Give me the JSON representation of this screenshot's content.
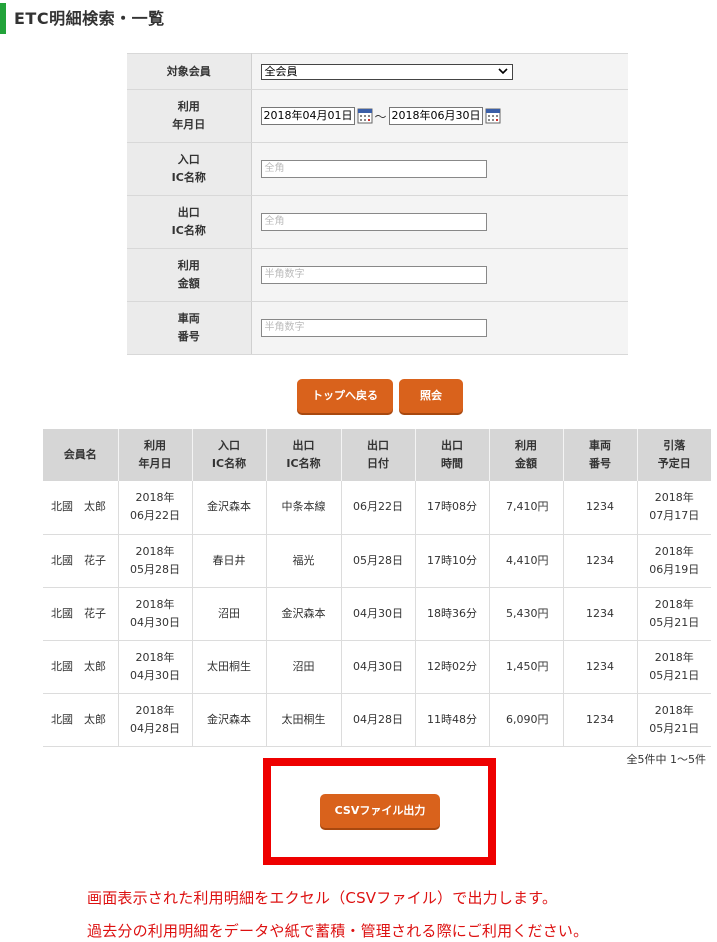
{
  "page": {
    "title": "ETC明細検索・一覧",
    "accent": "#22a33a"
  },
  "form": {
    "member": {
      "label": "対象会員",
      "value": "全会員"
    },
    "period": {
      "label1": "利用",
      "label2": "年月日",
      "from": "2018年04月01日",
      "separator": "～",
      "to": "2018年06月30日"
    },
    "entry_ic": {
      "label1": "入口",
      "label2": "IC名称",
      "placeholder": "全角"
    },
    "exit_ic": {
      "label1": "出口",
      "label2": "IC名称",
      "placeholder": "全角"
    },
    "amount": {
      "label1": "利用",
      "label2": "金額",
      "placeholder": "半角数字"
    },
    "vehicle": {
      "label1": "車両",
      "label2": "番号",
      "placeholder": "半角数字"
    }
  },
  "buttons": {
    "back_top": "トップへ戻る",
    "search": "照会",
    "csv": "CSVファイル出力",
    "color": "#d9621c"
  },
  "table": {
    "headers": [
      [
        "会員名",
        ""
      ],
      [
        "利用",
        "年月日"
      ],
      [
        "入口",
        "IC名称"
      ],
      [
        "出口",
        "IC名称"
      ],
      [
        "出口",
        "日付"
      ],
      [
        "出口",
        "時間"
      ],
      [
        "利用",
        "金額"
      ],
      [
        "車両",
        "番号"
      ],
      [
        "引落",
        "予定日"
      ]
    ],
    "rows": [
      {
        "member": "北國　太郎",
        "date1": "2018年",
        "date2": "06月22日",
        "entry": "金沢森本",
        "exit": "中条本線",
        "exit_date": "06月22日",
        "exit_time": "17時08分",
        "amount": "7,410円",
        "vehicle": "1234",
        "debit1": "2018年",
        "debit2": "07月17日"
      },
      {
        "member": "北國　花子",
        "date1": "2018年",
        "date2": "05月28日",
        "entry": "春日井",
        "exit": "福光",
        "exit_date": "05月28日",
        "exit_time": "17時10分",
        "amount": "4,410円",
        "vehicle": "1234",
        "debit1": "2018年",
        "debit2": "06月19日"
      },
      {
        "member": "北國　花子",
        "date1": "2018年",
        "date2": "04月30日",
        "entry": "沼田",
        "exit": "金沢森本",
        "exit_date": "04月30日",
        "exit_time": "18時36分",
        "amount": "5,430円",
        "vehicle": "1234",
        "debit1": "2018年",
        "debit2": "05月21日"
      },
      {
        "member": "北國　太郎",
        "date1": "2018年",
        "date2": "04月30日",
        "entry": "太田桐生",
        "exit": "沼田",
        "exit_date": "04月30日",
        "exit_time": "12時02分",
        "amount": "1,450円",
        "vehicle": "1234",
        "debit1": "2018年",
        "debit2": "05月21日"
      },
      {
        "member": "北國　太郎",
        "date1": "2018年",
        "date2": "04月28日",
        "entry": "金沢森本",
        "exit": "太田桐生",
        "exit_date": "04月28日",
        "exit_time": "11時48分",
        "amount": "6,090円",
        "vehicle": "1234",
        "debit1": "2018年",
        "debit2": "05月21日"
      }
    ],
    "count": "全5件中 1～5件"
  },
  "notes": {
    "line1": "画面表示された利用明細をエクセル（CSVファイル）で出力します。",
    "line2": "過去分の利用明細をデータや紙で蓄積・管理される際にご利用ください。",
    "color": "#dd1111"
  },
  "highlight_color": "#ee0000"
}
